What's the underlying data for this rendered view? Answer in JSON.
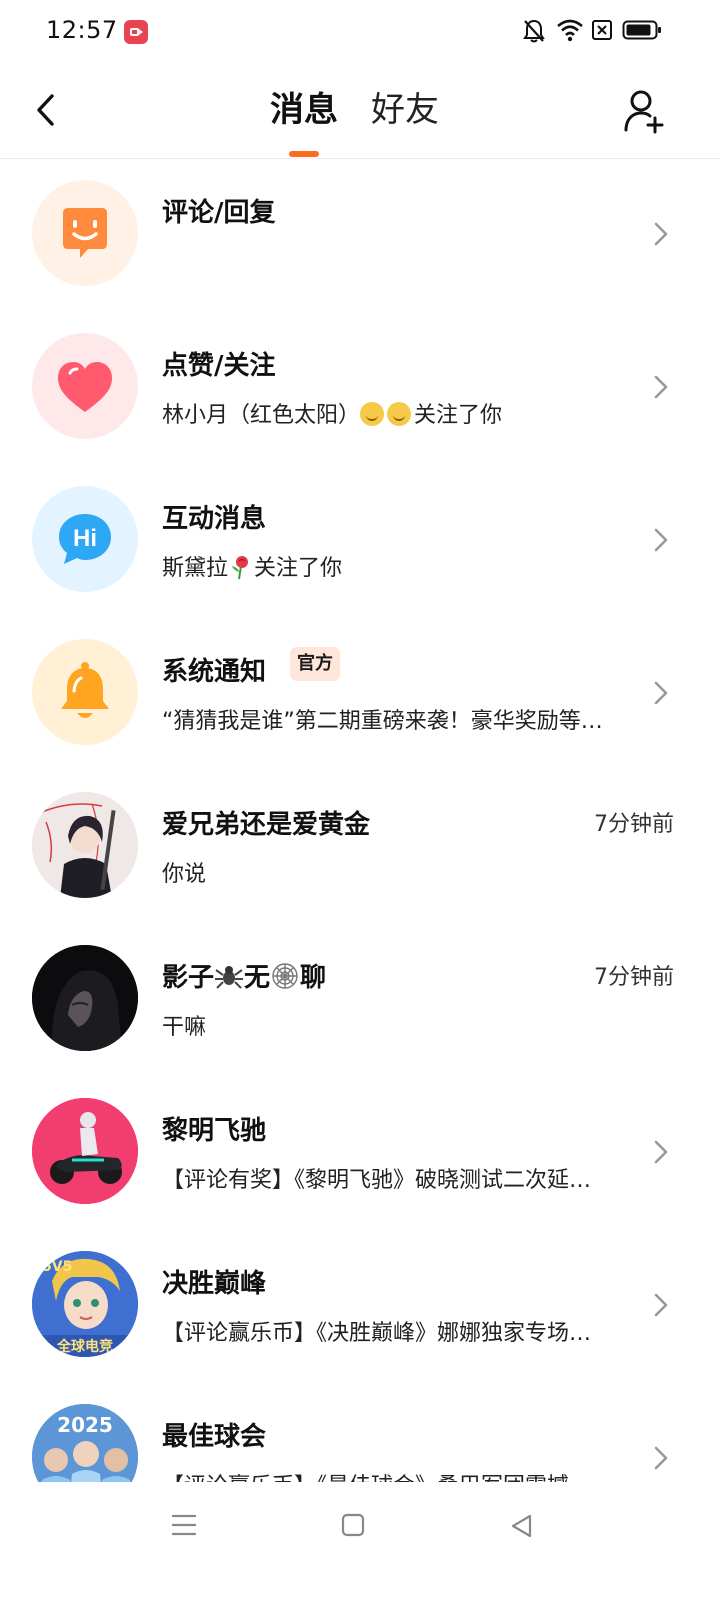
{
  "status_bar": {
    "time": "12:57"
  },
  "header": {
    "tabs": [
      {
        "label": "消息",
        "active": true
      },
      {
        "label": "好友",
        "active": false
      }
    ],
    "accent": "#ff6a1f"
  },
  "messages": [
    {
      "title": "评论/回复",
      "subtitle": "",
      "icon": "comment-face-icon",
      "bg": "#fff1e6"
    },
    {
      "title": "点赞/关注",
      "subtitle_before": "林小月（红色太阳）",
      "subtitle_after": "关注了你",
      "icon": "heart-icon",
      "bg": "#ffe8ea"
    },
    {
      "title": "互动消息",
      "subtitle_before": "斯黛拉",
      "subtitle_after": "关注了你",
      "icon": "hi-bubble-icon",
      "bg": "#e3f3ff"
    },
    {
      "title": "系统通知",
      "badge": "官方",
      "subtitle": "“猜猜我是谁”第二期重磅来袭！豪华奖励等…",
      "icon": "bell-icon",
      "bg": "#fff0d6"
    },
    {
      "title": "爱兄弟还是爱黄金",
      "subtitle": "你说",
      "time": "7分钟前",
      "icon": "user-avatar"
    },
    {
      "title_parts": [
        "影子",
        "无",
        "聊"
      ],
      "subtitle": "干嘛",
      "time": "7分钟前",
      "icon": "user-avatar"
    },
    {
      "title": "黎明飞驰",
      "subtitle": "【评论有奖】《黎明飞驰》破晓测试二次延…",
      "icon": "game-avatar"
    },
    {
      "title": "决胜巅峰",
      "subtitle": "【评论赢乐币】《决胜巅峰》娜娜独家专场…",
      "icon": "game-avatar",
      "avatar_text": "全球电竞"
    },
    {
      "title": "最佳球会",
      "subtitle": "【评论赢乐币】《最佳球会》桑巴军团震撼…",
      "icon": "game-avatar",
      "avatar_text": "2025"
    }
  ]
}
